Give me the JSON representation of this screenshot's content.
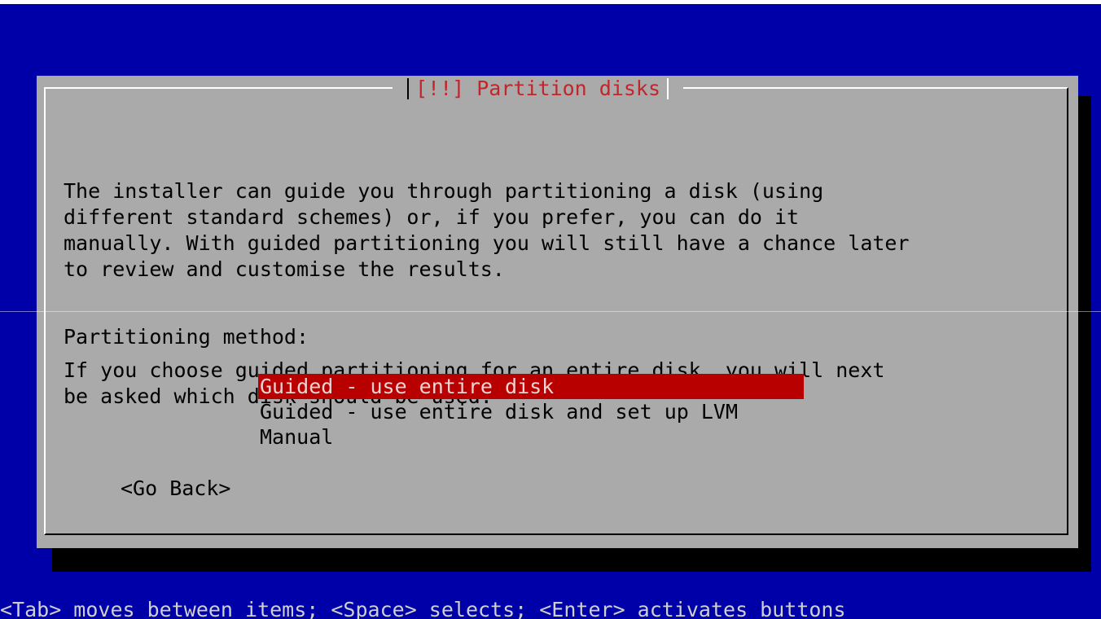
{
  "dialog": {
    "title": "[!!] Partition disks",
    "paragraph_1": "The installer can guide you through partitioning a disk (using\ndifferent standard schemes) or, if you prefer, you can do it\nmanually. With guided partitioning you will still have a chance later\nto review and customise the results.",
    "paragraph_2": "If you choose guided partitioning for an entire disk, you will next\nbe asked which disk should be used.",
    "method_label": "Partitioning method:",
    "options": [
      "Guided - use entire disk",
      "Guided - use entire disk and set up LVM",
      "Manual"
    ],
    "selected_option": "Guided - use entire disk",
    "back_button": "<Go Back>"
  },
  "status_bar": "<Tab> moves between items; <Space> selects; <Enter> activates buttons",
  "colors": {
    "background": "#0000a8",
    "dialog": "#aaaaaa",
    "title_text": "#c0262a",
    "selection": "#b80000"
  }
}
